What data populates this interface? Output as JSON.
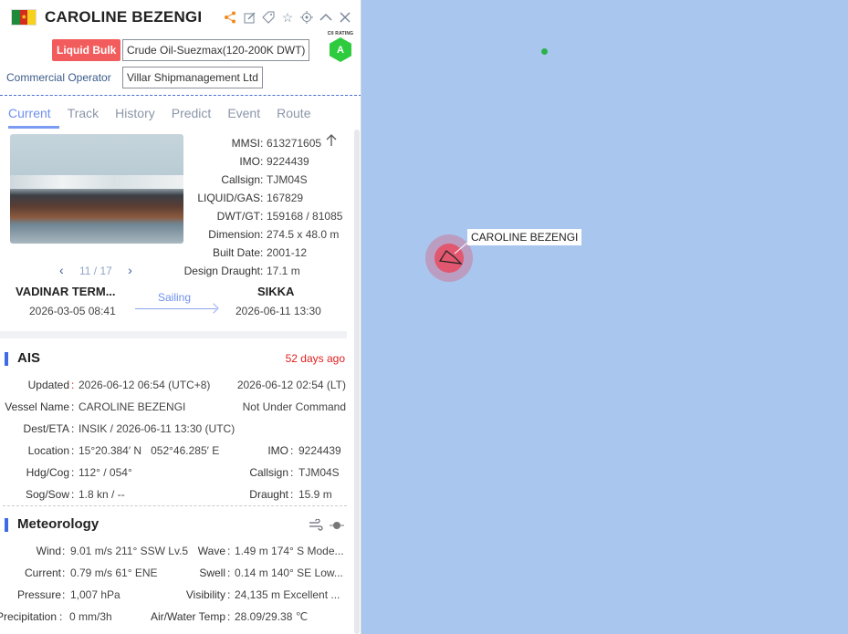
{
  "vessel": {
    "name": "CAROLINE BEZENGI",
    "type_tag": "Liquid Bulk",
    "subtype": "Crude Oil-Suezmax(120-200K DWT)",
    "commercial_operator_label": "Commercial Operator",
    "commercial_operator": "Villar Shipmanagement Ltd",
    "cii_label": "CII RATING",
    "cii_value": "A"
  },
  "header_icons": [
    "share-icon",
    "edit-icon",
    "tag-icon",
    "star-icon",
    "locate-icon",
    "chevron-up-icon",
    "close-icon"
  ],
  "tabs": [
    "Current",
    "Track",
    "History",
    "Predict",
    "Event",
    "Route"
  ],
  "details": {
    "mmsi_label": "MMSI",
    "mmsi": "613271605",
    "imo_label": "IMO",
    "imo": "9224439",
    "callsign_label": "Callsign",
    "callsign": "TJM04S",
    "liquid_label": "LIQUID/GAS",
    "liquid": "167829",
    "dwt_label": "DWT/GT",
    "dwt": "159168 / 81085",
    "dimension_label": "Dimension",
    "dimension": "274.5 x 48.0 m",
    "built_label": "Built Date",
    "built": "2001-12",
    "draught_label": "Design Draught",
    "draught": "17.1 m"
  },
  "photo_pager": "11 / 17",
  "voyage": {
    "from": "VADINAR TERM...",
    "from_date": "2026-03-05 08:41",
    "status": "Sailing",
    "to": "SIKKA",
    "to_date": "2026-06-11 13:30"
  },
  "ais": {
    "title": "AIS",
    "ago": "52 days ago",
    "updated_label": "Updated",
    "updated_utc": "2026-06-12 06:54 (UTC+8)",
    "updated_lt": "2026-06-12 02:54 (LT)",
    "vessel_name_label": "Vessel Name",
    "vessel_name": "CAROLINE BEZENGI",
    "nav_status": "Not Under Command",
    "dest_label": "Dest/ETA",
    "dest": "INSIK / 2026-06-11 13:30 (UTC)",
    "location_label": "Location",
    "location": "15°20.384′ N   052°46.285′ E",
    "imo_label": "IMO",
    "imo": "9224439",
    "hdg_label": "Hdg/Cog",
    "hdg": "112° / 054°",
    "callsign_label": "Callsign",
    "callsign": "TJM04S",
    "sog_label": "Sog/Sow",
    "sog": "1.8 kn / --",
    "draught_label": "Draught",
    "draught": "15.9 m"
  },
  "meteorology": {
    "title": "Meteorology",
    "wind_label": "Wind",
    "wind": "9.01 m/s 211° SSW Lv.5",
    "wave_label": "Wave",
    "wave": "1.49 m 174° S Mode...",
    "current_label": "Current",
    "current": "0.79 m/s 61° ENE",
    "swell_label": "Swell",
    "swell": "0.14 m 140° SE Low...",
    "pressure_label": "Pressure",
    "pressure": "1,007 hPa",
    "visibility_label": "Visibility",
    "visibility": "24,135 m Excellent ...",
    "precip_label": "Precipitation",
    "precip": "0 mm/3h",
    "temp_label": "Air/Water Temp",
    "temp": "28.09/29.38 ℃"
  },
  "map": {
    "ship_label": "CAROLINE BEZENGI",
    "sea_color": "#a9c6ef"
  },
  "colors": {
    "accent": "#6f8ff0",
    "tag": "#f25c5c",
    "alert": "#e02020",
    "cii": "#2ecb3e"
  }
}
